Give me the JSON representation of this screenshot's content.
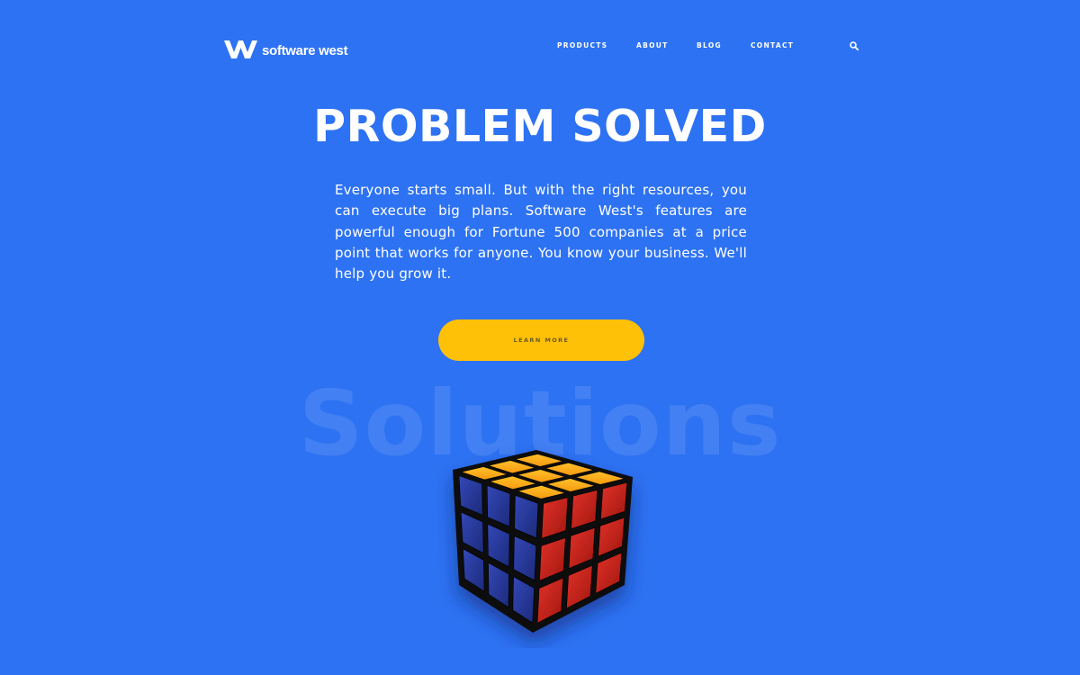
{
  "brand": {
    "name": "software west",
    "colors": {
      "background": "#2d72f2",
      "accent": "#ffc107",
      "text": "#ffffff"
    }
  },
  "nav": {
    "items": [
      {
        "label": "PRODUCTS"
      },
      {
        "label": "ABOUT"
      },
      {
        "label": "BLOG"
      },
      {
        "label": "CONTACT"
      }
    ],
    "search_icon": "search-icon"
  },
  "hero": {
    "title": "PROBLEM SOLVED",
    "body": "Everyone starts small. But with the right resources, you can execute big plans. Software West's features are powerful enough for Fortune 500 companies at a price point that works for anyone. You know your business. We'll help you grow it.",
    "cta_label": "LEARN MORE",
    "background_word": "Solutions",
    "illustration": "rubiks-cube"
  }
}
